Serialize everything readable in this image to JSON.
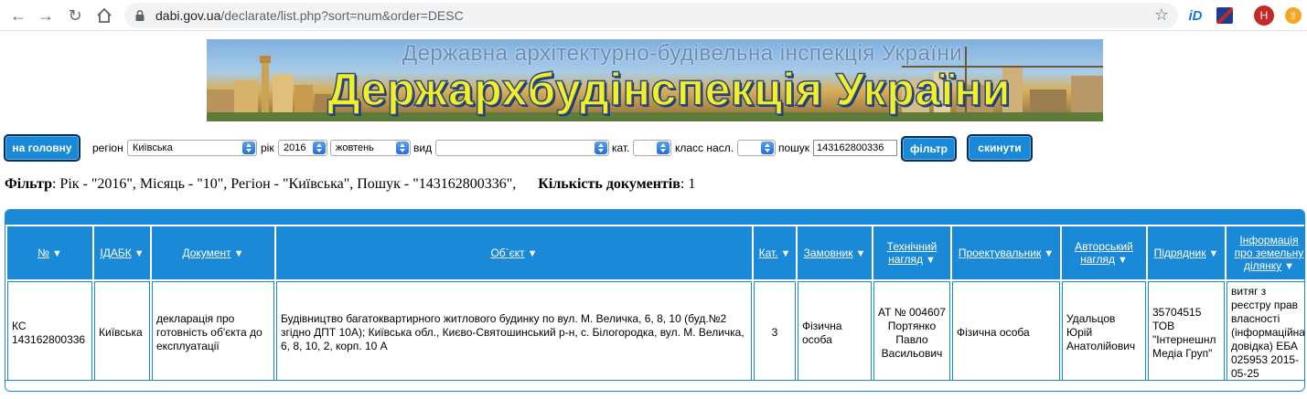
{
  "browser": {
    "url_host": "dabi.gov.ua",
    "url_path": "/declarate/list.php?sort=num&order=DESC",
    "ext_id_label": "iD",
    "profile_initial": "H"
  },
  "banner": {
    "subtitle": "Державна архітектурно-будівельна інспекція України",
    "title": "Держархбудінспекція України"
  },
  "filters": {
    "home_button": "на головну",
    "region_label": "регіон",
    "region_value": "Київська",
    "year_label": "рік",
    "year_value": "2016",
    "month_value": "жовтень",
    "type_label": "вид",
    "type_value": "",
    "cat_label": "кат.",
    "cat_value": "",
    "class_label": "класс насл.",
    "class_value": "",
    "search_label": "пошук",
    "search_value": "143162800336",
    "filter_button": "фільтр",
    "reset_button": "скинути"
  },
  "summary": {
    "filter_label": "Фільтр",
    "filter_text": ": Рік - \"2016\", Місяць - \"10\", Регіон - \"Київська\", Пошук - \"143162800336\",",
    "count_label": "Кількість документів",
    "count_text": ": 1"
  },
  "table": {
    "headers": [
      {
        "l1": "№",
        "l2": ""
      },
      {
        "l1": "ІДАБК",
        "l2": ""
      },
      {
        "l1": "Документ",
        "l2": ""
      },
      {
        "l1": "Об`єкт",
        "l2": ""
      },
      {
        "l1": "Кат.",
        "l2": ""
      },
      {
        "l1": "Замовник",
        "l2": ""
      },
      {
        "l1": "Технічний",
        "l2": "нагляд"
      },
      {
        "l1": "Проектувальник",
        "l2": ""
      },
      {
        "l1": "Авторський",
        "l2": "нагляд"
      },
      {
        "l1": "Підрядник",
        "l2": ""
      },
      {
        "l1": "Інформація",
        "l2": "про земельну",
        "l3": "ділянку"
      }
    ],
    "row": {
      "num": "КС 143162800336",
      "idabk": "Київська",
      "document": "декларація про готовність об'єкта до експлуатації",
      "object": "Будівництво багатоквартирного житлового будинку по вул. М. Величка, 6, 8, 10 (буд.№2 згідно ДПТ 10А); Київська обл., Києво-Святошинський р-н, с. Білогородка, вул. М. Величка, 6, 8, 10, 2, корп. 10 А",
      "cat": "3",
      "customer": "Фізична особа",
      "tech_supervision": "АТ № 004607 Портянко Павло Васильович",
      "designer": "Фізична особа",
      "author_supervision": "Удальцов Юрій Анатолійович",
      "contractor": "35704515 ТОВ \"Інтернешнл Медіа Груп\"",
      "land_info": "витяг з реєстру прав власності (інформаційна довідка) ЕБА 025953 2015-05-25"
    }
  },
  "colors": {
    "accent": "#1a8ad8",
    "button_border": "#0a2f57",
    "banner_title": "#f4ef22"
  }
}
